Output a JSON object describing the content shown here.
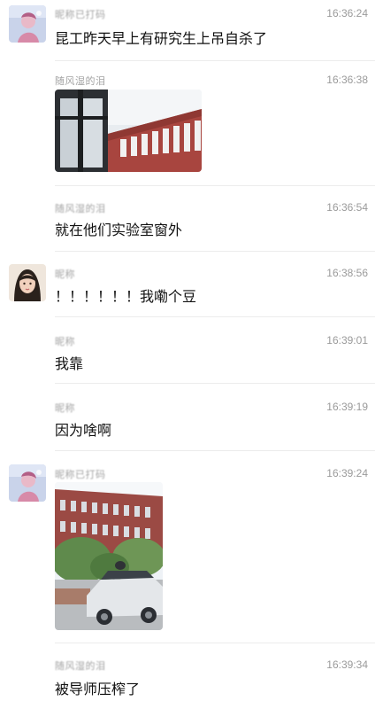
{
  "messages": [
    {
      "name": "昵称已打码",
      "time": "16:36:24",
      "text": "昆工昨天早上有研究生上吊自杀了"
    },
    {
      "name": "随风湿的泪",
      "time": "16:36:38"
    },
    {
      "name": "随风湿的泪",
      "time": "16:36:54",
      "text": "就在他们实验室窗外"
    },
    {
      "name": "昵称",
      "time": "16:38:56",
      "text": "！！！！！！我嘞个豆"
    },
    {
      "name": "昵称",
      "time": "16:39:01",
      "text": "我靠"
    },
    {
      "name": "昵称",
      "time": "16:39:19",
      "text": "因为啥啊"
    },
    {
      "name": "昵称已打码",
      "time": "16:39:24"
    },
    {
      "name": "随风湿的泪",
      "time": "16:39:34",
      "text": "被导师压榨了"
    }
  ],
  "colors": {
    "name": "#a3a3a3",
    "time": "#9a9a9a",
    "divider": "#ececec"
  }
}
